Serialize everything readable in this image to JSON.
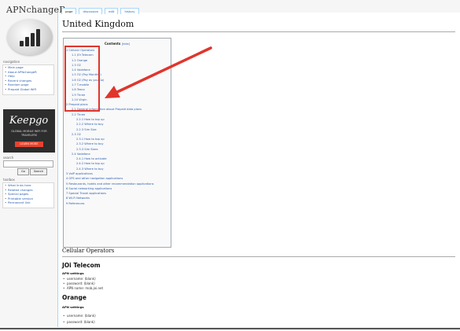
{
  "site": {
    "title": "APNchangeR"
  },
  "navigation": {
    "heading": "navigation",
    "items": [
      "Main page",
      "About APNchangeR",
      "Help",
      "Recent changes",
      "Random page",
      "Prepaid Global WiFi"
    ]
  },
  "ad": {
    "brand": "Keepgo",
    "tagline": "GLOBAL MOBILE WIFI FOR TRAVELERS",
    "button": "LEARN MORE"
  },
  "search": {
    "label": "search",
    "go_label": "Go",
    "search_label": "Search"
  },
  "toolbox": {
    "heading": "toolbox",
    "items": [
      "What links here",
      "Related changes",
      "Special pages",
      "Printable version",
      "Permanent link"
    ]
  },
  "tabs": [
    "page",
    "discussion",
    "edit",
    "history"
  ],
  "page": {
    "title": "United Kingdom"
  },
  "toc": {
    "title": "Contents",
    "hide": "[hide]",
    "items": [
      "1 Cellular Operators",
      "1.1 JOi Telecom",
      "1.2 Orange",
      "1.3 O2",
      "1.4 Vodafone",
      "1.5 O2 (Pay Monthly)",
      "1.6 O2 (Pay as you Go)",
      "1.7 T-mobile",
      "1.8 Tesco",
      "1.9 Three",
      "1.10 Virgin",
      "2 Prepaid plans",
      "2.1 General information about Prepaid data plans",
      "2.2 Three",
      "2.2.1 How to top up",
      "2.2.2 Where to buy",
      "2.2.3 Sim Size",
      "2.3 O2",
      "2.3.1 How to top up",
      "2.3.2 Where to buy",
      "2.3.3 Sim Sizes",
      "2.4 Vodafone",
      "2.4.1 How to activate",
      "2.4.2 How to top up",
      "2.4.3 Where to buy",
      "3 VoIP applications",
      "4 GPS and other navigation applications",
      "5 Restaurants, hotels and other recommendation applications",
      "6 Social networking applications",
      "7 Special Travel applications",
      "8 Wi-Fi Networks",
      "9 References"
    ]
  },
  "section": {
    "heading": "Cellular Operators",
    "operators": [
      {
        "name": "JOi Telecom",
        "apn_label": "APN settings",
        "settings": [
          "username: (blank)",
          "password: (blank)",
          "APN name: mob.joi.net"
        ]
      },
      {
        "name": "Orange",
        "apn_label": "APN settings",
        "settings": [
          "username: (blank)",
          "password: (blank)"
        ]
      }
    ]
  },
  "colors": {
    "highlight": "#e0352c",
    "link": "#2a5db0",
    "ad_bg": "#2d2d2d",
    "ad_button": "#e8432e"
  }
}
